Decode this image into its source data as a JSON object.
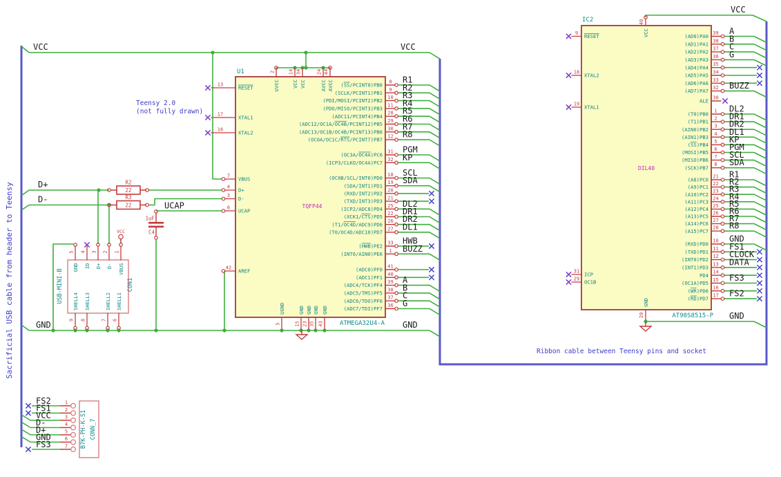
{
  "colors": {
    "wire": "#3CAF3C",
    "bus": "#5858C8",
    "component_outline": "#B04A4A",
    "component_fill": "#FBFBC4",
    "pin": "#C33A3A",
    "pin_name": "#0E8585",
    "reference": "#0F8A8A",
    "footprint": "#C028C0",
    "net_label": "#1B1B1B",
    "note": "#3C3CC8",
    "no_connect": "#4646C8",
    "no_connect_pin": "#7D3FC8",
    "connector_outline": "#DA8585",
    "background": "#FFFFFF"
  },
  "notes": {
    "left_vertical": "Sacrificial USB cable from header to Teensy",
    "teensy_line1": "Teensy 2.0",
    "teensy_line2": "(not fully drawn)",
    "ribbon": "Ribbon cable between Teensy pins and socket"
  },
  "labels": {
    "vcc": "VCC",
    "gnd": "GND",
    "dplus": "D+",
    "dminus": "D-",
    "ucap": "UCAP"
  },
  "u1": {
    "ref": "U1",
    "value": "ATMEGA32U4-A",
    "package": "TQFP44",
    "top_pins": [
      {
        "num": "2",
        "name": "UVCC"
      },
      {
        "num": "14",
        "name": "VCC"
      },
      {
        "num": "34",
        "name": "VCC"
      },
      {
        "num": "24",
        "name": "AVCC"
      },
      {
        "num": "44",
        "name": "AVCC"
      }
    ],
    "bottom_pins": [
      {
        "num": "5",
        "name": "UGND"
      },
      {
        "num": "15",
        "name": "GND"
      },
      {
        "num": "23",
        "name": "GND"
      },
      {
        "num": "35",
        "name": "GND"
      },
      {
        "num": "43",
        "name": "GND"
      }
    ],
    "left_pins": [
      {
        "num": "13",
        "name": "~RESET~",
        "term": "nc"
      },
      {
        "num": "17",
        "name": "XTAL1",
        "term": "nc"
      },
      {
        "num": "16",
        "name": "XTAL2",
        "term": "nc"
      },
      {
        "num": "7",
        "name": "VBUS",
        "term": "wire"
      },
      {
        "num": "4",
        "name": "D+",
        "term": "wire"
      },
      {
        "num": "3",
        "name": "D-",
        "term": "wire"
      },
      {
        "num": "6",
        "name": "UCAP",
        "term": "wire"
      },
      {
        "num": "42",
        "name": "AREF",
        "term": "wire"
      }
    ],
    "right_pins": [
      {
        "num": "8",
        "name": "(~SS~/PCINT0)PB0",
        "label": "R1",
        "term": "bus"
      },
      {
        "num": "9",
        "name": "(SCLK/PCINT1)PB1",
        "label": "R2",
        "term": "bus"
      },
      {
        "num": "10",
        "name": "(PDI/MOSI/PCINT2)PB2",
        "label": "R3",
        "term": "bus"
      },
      {
        "num": "11",
        "name": "(PDO/MISO/PCINT3)PB3",
        "label": "R4",
        "term": "bus"
      },
      {
        "num": "28",
        "name": "(ADC11/PCINT4)PB4",
        "label": "R5",
        "term": "bus"
      },
      {
        "num": "29",
        "name": "(ADC12/OC1A/~OC4B~/PCINT12)PB5",
        "label": "R6",
        "term": "bus"
      },
      {
        "num": "30",
        "name": "(ADC13/OC1B/OC4B/PCINT13)PB6",
        "label": "R7",
        "term": "bus"
      },
      {
        "num": "12",
        "name": "(OC0A/OC1C/~RTS~/PCINT7)PB7",
        "label": "R8",
        "term": "bus"
      },
      {
        "num": "31",
        "name": "(OC3A/~OC4A~)PC6",
        "label": "PGM",
        "term": "bus"
      },
      {
        "num": "32",
        "name": "(ICP3/CLKO/OC4A)PC7",
        "label": "KP",
        "term": "bus"
      },
      {
        "num": "18",
        "name": "(OC0B/SCL/INT0)PD0",
        "label": "SCL",
        "term": "bus"
      },
      {
        "num": "19",
        "name": "(SDA/INT1)PD1",
        "label": "SDA",
        "term": "bus"
      },
      {
        "num": "20",
        "name": "(RXD/INT2)PD2",
        "label": "",
        "term": "nc"
      },
      {
        "num": "21",
        "name": "(TXD/INT3)PD3",
        "label": "",
        "term": "nc"
      },
      {
        "num": "25",
        "name": "(ICP2/ADC8)PD4",
        "label": "DL2",
        "term": "bus"
      },
      {
        "num": "22",
        "name": "(XCK1/~CTS~)PD5",
        "label": "DR1",
        "term": "bus"
      },
      {
        "num": "26",
        "name": "(T1/~OC4D~/ADC9)PD6",
        "label": "DR2",
        "term": "bus"
      },
      {
        "num": "27",
        "name": "(T0/OC4D/ADC10)PD7",
        "label": "DL1",
        "term": "bus"
      },
      {
        "num": "33",
        "name": "(~HWB~)PE2",
        "label": "HWB",
        "term": "nc"
      },
      {
        "num": "1",
        "name": "(INT6/AIN0)PE6",
        "label": "BUZZ",
        "term": "bus"
      },
      {
        "num": "41",
        "name": "(ADC0)PF0",
        "label": "",
        "term": "nc"
      },
      {
        "num": "40",
        "name": "(ADC1)PF1",
        "label": "",
        "term": "nc"
      },
      {
        "num": "39",
        "name": "(ADC4/TCK)PF4",
        "label": "A",
        "term": "bus"
      },
      {
        "num": "38",
        "name": "(ADC5/TMS)PF5",
        "label": "B",
        "term": "bus"
      },
      {
        "num": "37",
        "name": "(ADC6/TDO)PF6",
        "label": "C",
        "term": "bus"
      },
      {
        "num": "36",
        "name": "(ADC7/TDI)PF7",
        "label": "G",
        "term": "bus"
      }
    ]
  },
  "ic2": {
    "ref": "IC2",
    "value": "AT90S8515-P",
    "package": "DIL40",
    "top_pins": [
      {
        "num": "40",
        "name": "VCC"
      }
    ],
    "bottom_pins": [
      {
        "num": "20",
        "name": "GND"
      }
    ],
    "left_pins": [
      {
        "num": "9",
        "name": "~RESET~"
      },
      {
        "num": "18",
        "name": "XTAL2"
      },
      {
        "num": "19",
        "name": "XTAL1"
      },
      {
        "num": "31",
        "name": "ICP"
      },
      {
        "num": "29",
        "name": "OC1B"
      }
    ],
    "right_pins": [
      {
        "num": "39",
        "name": "(AD0)PA0",
        "label": "A",
        "term": "bus"
      },
      {
        "num": "38",
        "name": "(AD1)PA1",
        "label": "B",
        "term": "bus"
      },
      {
        "num": "37",
        "name": "(AD2)PA2",
        "label": "C",
        "term": "bus"
      },
      {
        "num": "36",
        "name": "(AD3)PA3",
        "label": "G",
        "term": "bus"
      },
      {
        "num": "35",
        "name": "(AD4)PA4",
        "label": "",
        "term": "nc"
      },
      {
        "num": "34",
        "name": "(AD5)PA5",
        "label": "",
        "term": "nc"
      },
      {
        "num": "33",
        "name": "(AD6)PA6",
        "label": "",
        "term": "nc"
      },
      {
        "num": "32",
        "name": "(AD7)PA7",
        "label": "BUZZ",
        "term": "bus"
      },
      {
        "num": "30",
        "name": "ALE",
        "label": "",
        "term": "ncshort"
      },
      {
        "num": "1",
        "name": "(T0)PB0",
        "label": "DL2",
        "term": "bus"
      },
      {
        "num": "2",
        "name": "(T1)PB1",
        "label": "DR1",
        "term": "bus"
      },
      {
        "num": "3",
        "name": "(AIN0)PB2",
        "label": "DR2",
        "term": "bus"
      },
      {
        "num": "4",
        "name": "(AIN1)PB3",
        "label": "DL1",
        "term": "bus"
      },
      {
        "num": "5",
        "name": "(~SS~)PB4",
        "label": "KP",
        "term": "bus"
      },
      {
        "num": "6",
        "name": "(MOSI)PB5",
        "label": "PGM",
        "term": "bus"
      },
      {
        "num": "7",
        "name": "(MISO)PB6",
        "label": "SCL",
        "term": "bus"
      },
      {
        "num": "8",
        "name": "(SCK)PB7",
        "label": "SDA",
        "term": "bus"
      },
      {
        "num": "21",
        "name": "(A8)PC0",
        "label": "R1",
        "term": "bus"
      },
      {
        "num": "22",
        "name": "(A9)PC1",
        "label": "R2",
        "term": "bus"
      },
      {
        "num": "23",
        "name": "(A10)PC2",
        "label": "R3",
        "term": "bus"
      },
      {
        "num": "24",
        "name": "(A11)PC3",
        "label": "R4",
        "term": "bus"
      },
      {
        "num": "25",
        "name": "(A12)PC4",
        "label": "R5",
        "term": "bus"
      },
      {
        "num": "26",
        "name": "(A13)PC5",
        "label": "R6",
        "term": "bus"
      },
      {
        "num": "27",
        "name": "(A14)PC6",
        "label": "R7",
        "term": "bus"
      },
      {
        "num": "28",
        "name": "(A15)PC7",
        "label": "R8",
        "term": "bus"
      },
      {
        "num": "10",
        "name": "(RXD)PD0",
        "label": "GND",
        "term": "bus"
      },
      {
        "num": "11",
        "name": "(TXD)PD1",
        "label": "FS1",
        "term": "nc"
      },
      {
        "num": "12",
        "name": "(INT0)PD2",
        "label": "CLOCK",
        "term": "nc"
      },
      {
        "num": "13",
        "name": "(INT1)PD3",
        "label": "DATA",
        "term": "nc"
      },
      {
        "num": "14",
        "name": "PD4",
        "label": "",
        "term": "nc"
      },
      {
        "num": "15",
        "name": "(OC1A)PD5",
        "label": "FS3",
        "term": "nc"
      },
      {
        "num": "16",
        "name": "(~WR~)PD6",
        "label": "",
        "term": "nc"
      },
      {
        "num": "17",
        "name": "(~RD~)PD7",
        "label": "FS2",
        "term": "nc"
      }
    ]
  },
  "con1": {
    "ref": "CON1",
    "value": "USB-MINI-B",
    "top_pins": [
      {
        "num": "5",
        "name": "GND"
      },
      {
        "num": "4",
        "name": "ID"
      },
      {
        "num": "3",
        "name": "D+"
      },
      {
        "num": "2",
        "name": "D-"
      },
      {
        "num": "1",
        "name": "VBUS"
      }
    ],
    "bottom_pins": [
      {
        "num": "9",
        "name": "SHELL4"
      },
      {
        "num": "8",
        "name": "SHELL3"
      },
      {
        "num": "7",
        "name": "SHELL2"
      },
      {
        "num": "6",
        "name": "SHELL1"
      }
    ]
  },
  "conn7": {
    "ref": "CONN_7",
    "value": "B7K-PH-K-S1",
    "pins": [
      {
        "num": "1",
        "label": "FS2",
        "term": "nc"
      },
      {
        "num": "2",
        "label": "FS1",
        "term": "nc"
      },
      {
        "num": "3",
        "label": "VCC",
        "term": "bus"
      },
      {
        "num": "4",
        "label": "D-",
        "term": "bus"
      },
      {
        "num": "5",
        "label": "D+",
        "term": "bus"
      },
      {
        "num": "6",
        "label": "GND",
        "term": "bus"
      },
      {
        "num": "7",
        "label": "FS3",
        "term": "nc"
      }
    ]
  },
  "r2": {
    "ref": "R2",
    "value": "22"
  },
  "r3": {
    "ref": "R3",
    "value": "22"
  },
  "c4": {
    "ref": "C4",
    "value": "1uF"
  },
  "vcc_symbol": {
    "label": "VCC"
  }
}
